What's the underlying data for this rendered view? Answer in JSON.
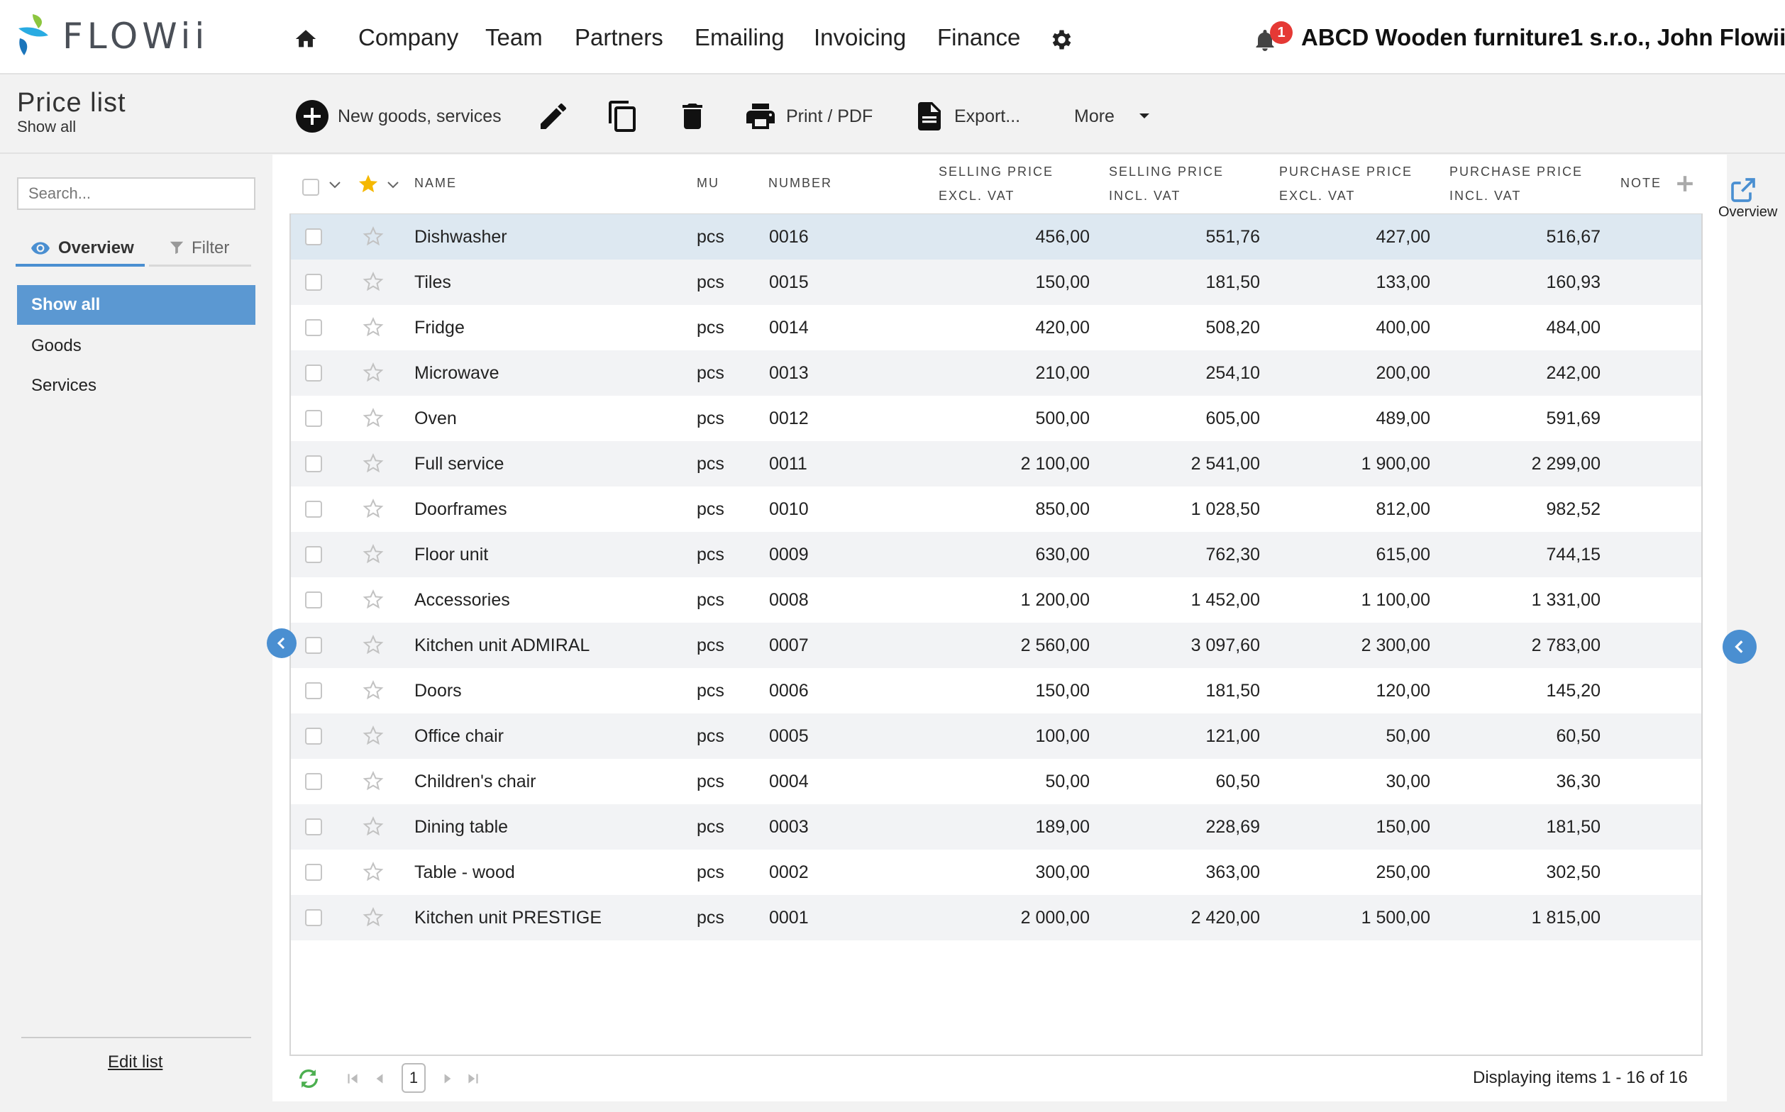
{
  "app": {
    "logo_text": "FLOWii"
  },
  "nav": {
    "items": [
      "Company",
      "Team",
      "Partners",
      "Emailing",
      "Invoicing",
      "Finance"
    ],
    "notifications_count": "1",
    "account": "ABCD Wooden furniture1 s.r.o., John Flowii"
  },
  "page": {
    "title": "Price list",
    "subtitle": "Show all"
  },
  "toolbar": {
    "new_label": "New goods, services",
    "print_label": "Print / PDF",
    "export_label": "Export...",
    "more_label": "More"
  },
  "sidebar": {
    "search_placeholder": "Search...",
    "tab_overview": "Overview",
    "tab_filter": "Filter",
    "items": [
      "Show all",
      "Goods",
      "Services"
    ],
    "edit_list": "Edit list"
  },
  "table": {
    "headers": {
      "name": "NAME",
      "mu": "MU",
      "number": "NUMBER",
      "sell_excl_1": "SELLING PRICE",
      "sell_excl_2": "EXCL. VAT",
      "sell_incl_1": "SELLING PRICE",
      "sell_incl_2": "INCL. VAT",
      "purch_excl_1": "PURCHASE PRICE",
      "purch_excl_2": "EXCL. VAT",
      "purch_incl_1": "PURCHASE PRICE",
      "purch_incl_2": "INCL. VAT",
      "note": "NOTE"
    },
    "rows": [
      {
        "name": "Dishwasher",
        "mu": "pcs",
        "number": "0016",
        "sell_excl": "456,00",
        "sell_incl": "551,76",
        "purch_excl": "427,00",
        "purch_incl": "516,67"
      },
      {
        "name": "Tiles",
        "mu": "pcs",
        "number": "0015",
        "sell_excl": "150,00",
        "sell_incl": "181,50",
        "purch_excl": "133,00",
        "purch_incl": "160,93"
      },
      {
        "name": "Fridge",
        "mu": "pcs",
        "number": "0014",
        "sell_excl": "420,00",
        "sell_incl": "508,20",
        "purch_excl": "400,00",
        "purch_incl": "484,00"
      },
      {
        "name": "Microwave",
        "mu": "pcs",
        "number": "0013",
        "sell_excl": "210,00",
        "sell_incl": "254,10",
        "purch_excl": "200,00",
        "purch_incl": "242,00"
      },
      {
        "name": "Oven",
        "mu": "pcs",
        "number": "0012",
        "sell_excl": "500,00",
        "sell_incl": "605,00",
        "purch_excl": "489,00",
        "purch_incl": "591,69"
      },
      {
        "name": "Full service",
        "mu": "pcs",
        "number": "0011",
        "sell_excl": "2 100,00",
        "sell_incl": "2 541,00",
        "purch_excl": "1 900,00",
        "purch_incl": "2 299,00"
      },
      {
        "name": "Doorframes",
        "mu": "pcs",
        "number": "0010",
        "sell_excl": "850,00",
        "sell_incl": "1 028,50",
        "purch_excl": "812,00",
        "purch_incl": "982,52"
      },
      {
        "name": "Floor unit",
        "mu": "pcs",
        "number": "0009",
        "sell_excl": "630,00",
        "sell_incl": "762,30",
        "purch_excl": "615,00",
        "purch_incl": "744,15"
      },
      {
        "name": "Accessories",
        "mu": "pcs",
        "number": "0008",
        "sell_excl": "1 200,00",
        "sell_incl": "1 452,00",
        "purch_excl": "1 100,00",
        "purch_incl": "1 331,00"
      },
      {
        "name": "Kitchen unit ADMIRAL",
        "mu": "pcs",
        "number": "0007",
        "sell_excl": "2 560,00",
        "sell_incl": "3 097,60",
        "purch_excl": "2 300,00",
        "purch_incl": "2 783,00"
      },
      {
        "name": "Doors",
        "mu": "pcs",
        "number": "0006",
        "sell_excl": "150,00",
        "sell_incl": "181,50",
        "purch_excl": "120,00",
        "purch_incl": "145,20"
      },
      {
        "name": "Office chair",
        "mu": "pcs",
        "number": "0005",
        "sell_excl": "100,00",
        "sell_incl": "121,00",
        "purch_excl": "50,00",
        "purch_incl": "60,50"
      },
      {
        "name": "Children's chair",
        "mu": "pcs",
        "number": "0004",
        "sell_excl": "50,00",
        "sell_incl": "60,50",
        "purch_excl": "30,00",
        "purch_incl": "36,30"
      },
      {
        "name": "Dining table",
        "mu": "pcs",
        "number": "0003",
        "sell_excl": "189,00",
        "sell_incl": "228,69",
        "purch_excl": "150,00",
        "purch_incl": "181,50"
      },
      {
        "name": "Table - wood",
        "mu": "pcs",
        "number": "0002",
        "sell_excl": "300,00",
        "sell_incl": "363,00",
        "purch_excl": "250,00",
        "purch_incl": "302,50"
      },
      {
        "name": "Kitchen unit PRESTIGE",
        "mu": "pcs",
        "number": "0001",
        "sell_excl": "2 000,00",
        "sell_incl": "2 420,00",
        "purch_excl": "1 500,00",
        "purch_incl": "1 815,00"
      }
    ]
  },
  "right_panel": {
    "overview_label": "Overview"
  },
  "pager": {
    "page": "1",
    "info": "Displaying items 1 - 16 of 16"
  },
  "colors": {
    "accent": "#4a8fd1",
    "selected_row": "#dde8f1",
    "star_active": "#f5b800",
    "badge": "#e53935"
  }
}
